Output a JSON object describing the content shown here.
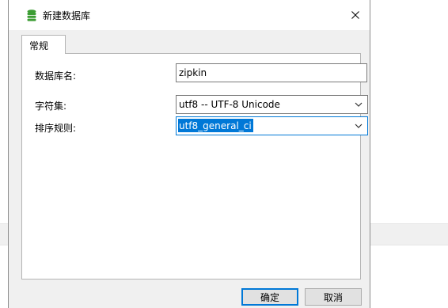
{
  "window": {
    "title": "新建数据库",
    "icon": "database-icon"
  },
  "tabs": [
    {
      "label": "常规",
      "active": true
    }
  ],
  "form": {
    "db_name_label": "数据库名:",
    "db_name_value": "zipkin",
    "charset_label": "字符集:",
    "charset_value": "utf8 -- UTF-8 Unicode",
    "collation_label": "排序规则:",
    "collation_value": "utf8_general_ci"
  },
  "buttons": {
    "ok_label": "确定",
    "cancel_label": "取消"
  },
  "colors": {
    "accent": "#0078d7",
    "db_icon": "#3c9d34"
  }
}
